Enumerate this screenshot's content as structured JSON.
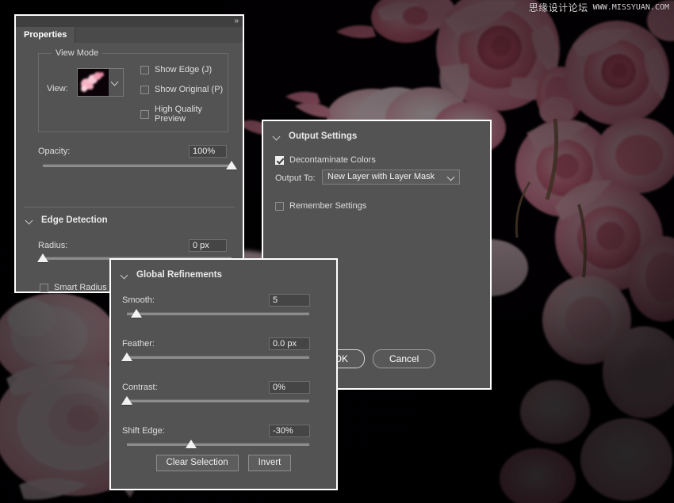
{
  "watermark": {
    "site_cn": "思缘设计论坛",
    "site_url": "WWW.MISSYUAN.COM"
  },
  "properties_panel": {
    "collapse_icon": "»",
    "tab_label": "Properties",
    "view_mode": {
      "legend": "View Mode",
      "view_label": "View:",
      "checkboxes": [
        {
          "label": "Show Edge (J)",
          "checked": false
        },
        {
          "label": "Show Original (P)",
          "checked": false
        },
        {
          "label": "High Quality Preview",
          "checked": false
        }
      ]
    },
    "opacity": {
      "label": "Opacity:",
      "value": "100%",
      "percent": 100
    },
    "edge_detection": {
      "header": "Edge Detection",
      "radius": {
        "label": "Radius:",
        "value": "0 px",
        "percent": 0
      },
      "smart_radius": {
        "label": "Smart Radius",
        "checked": false
      }
    }
  },
  "output_panel": {
    "header": "Output Settings",
    "decontaminate": {
      "label": "Decontaminate Colors",
      "checked": true
    },
    "output_to": {
      "label": "Output To:",
      "value": "New Layer with Layer Mask"
    },
    "remember": {
      "label": "Remember Settings",
      "checked": false
    },
    "ok_label": "OK",
    "cancel_label": "Cancel"
  },
  "global_panel": {
    "header": "Global Refinements",
    "sliders": [
      {
        "label": "Smooth:",
        "value": "5",
        "percent": 5
      },
      {
        "label": "Feather:",
        "value": "0.0 px",
        "percent": 0
      },
      {
        "label": "Contrast:",
        "value": "0%",
        "percent": 0
      },
      {
        "label": "Shift Edge:",
        "value": "-30%",
        "percent": 35
      }
    ],
    "clear_selection_label": "Clear Selection",
    "invert_label": "Invert"
  },
  "colors": {
    "panel_bg": "#535353",
    "panel_border": "#ffffff",
    "text": "#e6e6e6",
    "canvas_bg": "#000000",
    "rose_pink": "#f08aa8"
  }
}
